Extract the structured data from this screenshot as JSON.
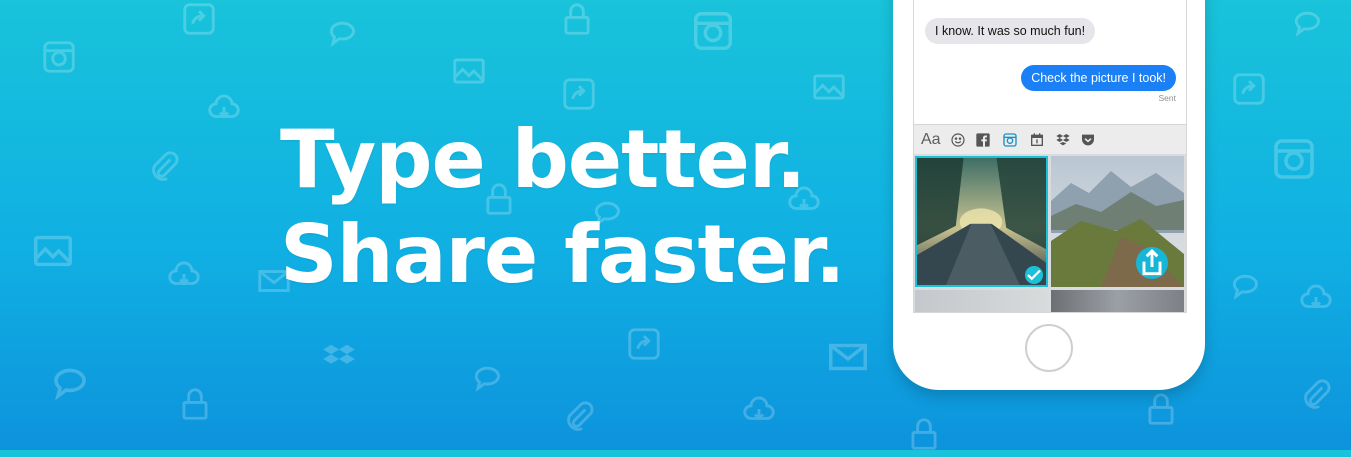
{
  "headline": {
    "line1": "Type better.",
    "line2": "Share faster."
  },
  "messages": {
    "received": "I know. It was so much fun!",
    "sent": "Check the picture I took!",
    "sent_status": "Sent"
  },
  "keyboard_toolbar": {
    "font_label": "Aa",
    "items": [
      "font-icon",
      "emoji-icon",
      "facebook-icon",
      "instagram-icon",
      "calendar-icon",
      "dropbox-icon",
      "pocket-icon"
    ]
  },
  "colors": {
    "background_top": "#19c3da",
    "background_bottom": "#0d93dc",
    "sent_bubble": "#1b7ff5",
    "received_bubble": "#e6e6ea",
    "selection_accent": "#1cc1d8"
  }
}
